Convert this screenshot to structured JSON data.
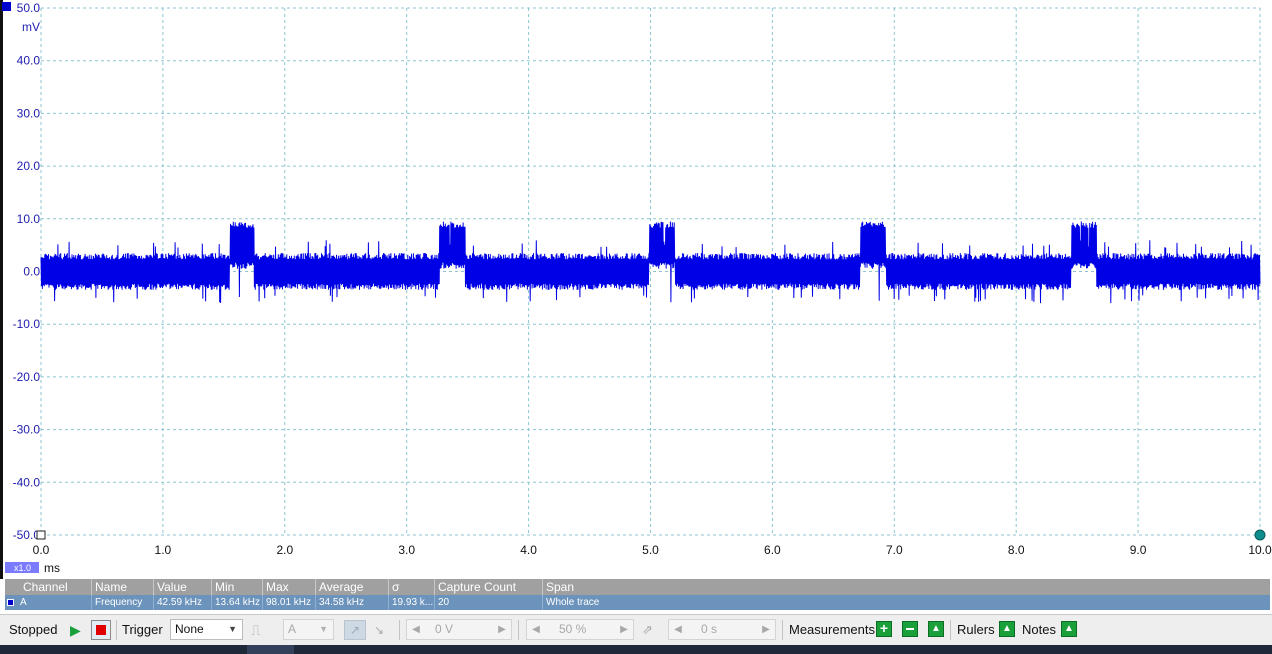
{
  "chart_data": {
    "type": "line",
    "y_unit": "mV",
    "x_unit": "ms",
    "x_scale_badge": "x1.0",
    "ylim": [
      -50.0,
      50.0
    ],
    "xlim": [
      0.0,
      10.0
    ],
    "y_ticks": [
      "50.0",
      "40.0",
      "30.0",
      "20.0",
      "10.0",
      "0.0",
      "-10.0",
      "-20.0",
      "-30.0",
      "-40.0",
      "-50.0"
    ],
    "y_tick_values": [
      50,
      40,
      30,
      20,
      10,
      0,
      -10,
      -20,
      -30,
      -40,
      -50
    ],
    "x_ticks": [
      "0.0",
      "1.0",
      "2.0",
      "3.0",
      "4.0",
      "5.0",
      "6.0",
      "7.0",
      "8.0",
      "9.0",
      "10.0"
    ],
    "x_tick_values": [
      0,
      1,
      2,
      3,
      4,
      5,
      6,
      7,
      8,
      9,
      10
    ],
    "grid": true,
    "series": [
      {
        "channel": "A",
        "color": "#0000e6",
        "baseline_envelope_mV": [
          -3.5,
          3.5
        ],
        "noise_spike_range_mV": [
          -6,
          6
        ],
        "bursts": [
          {
            "x_start": 1.55,
            "x_end": 1.75,
            "envelope_mV": [
              0.5,
              9.5
            ]
          },
          {
            "x_start": 3.27,
            "x_end": 3.48,
            "envelope_mV": [
              0.5,
              9.5
            ]
          },
          {
            "x_start": 4.99,
            "x_end": 5.2,
            "envelope_mV": [
              0.5,
              9.5
            ]
          },
          {
            "x_start": 6.72,
            "x_end": 6.93,
            "envelope_mV": [
              0.5,
              9.5
            ]
          },
          {
            "x_start": 8.45,
            "x_end": 8.66,
            "envelope_mV": [
              0.5,
              9.5
            ]
          }
        ]
      }
    ]
  },
  "measurements": {
    "headers": [
      "Channel",
      "Name",
      "Value",
      "Min",
      "Max",
      "Average",
      "σ",
      "Capture Count",
      "Span"
    ],
    "rows": [
      {
        "channel": "A",
        "name": "Frequency",
        "value": "42.59 kHz",
        "min": "13.64 kHz",
        "max": "98.01 kHz",
        "average": "34.58 kHz",
        "sigma": "19.93 k...",
        "capture_count": "20",
        "span": "Whole trace"
      }
    ]
  },
  "toolbar": {
    "status": "Stopped",
    "trigger_label": "Trigger",
    "trigger_mode": "None",
    "trigger_channel": "A",
    "threshold": "0 V",
    "pretrigger": "50 %",
    "delay": "0 s",
    "measurements_label": "Measurements",
    "rulers_label": "Rulers",
    "notes_label": "Notes",
    "colors": {
      "green": "#19a03a",
      "stop_red": "#e00000",
      "accent_blue": "#6b93bb"
    }
  }
}
